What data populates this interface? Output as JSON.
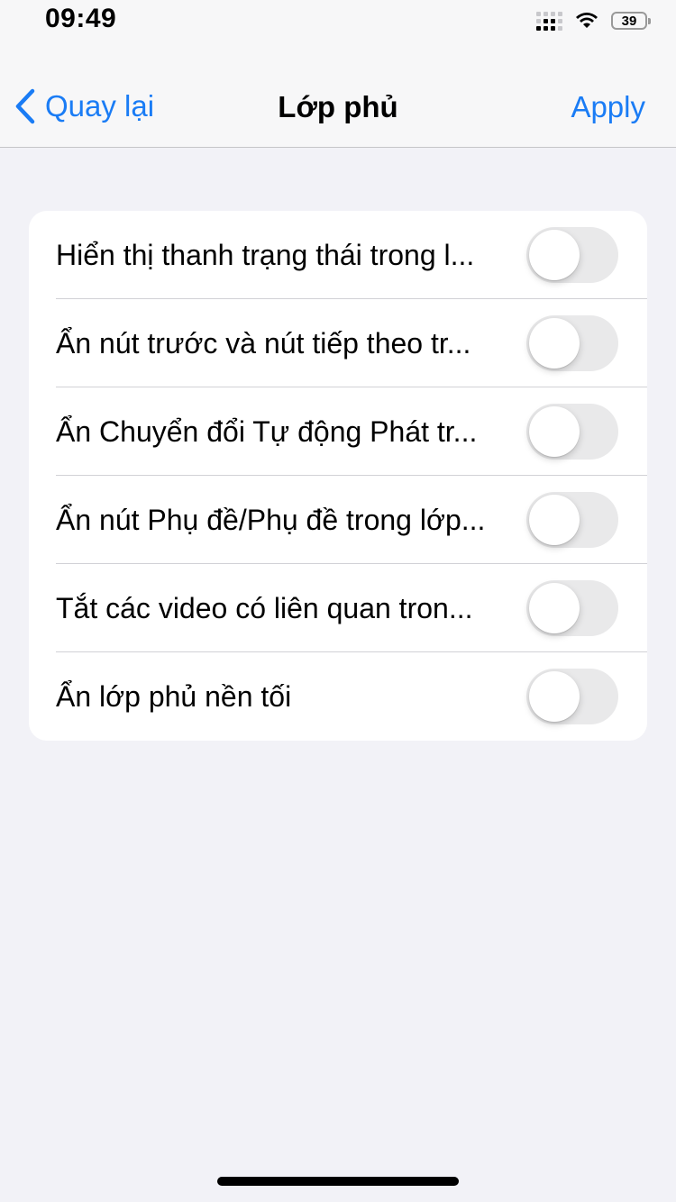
{
  "status_bar": {
    "time": "09:49",
    "battery": "39",
    "icons": [
      "cellular-signal-icon",
      "wifi-icon",
      "battery-icon"
    ]
  },
  "nav": {
    "back_label": "Quay lại",
    "title": "Lớp phủ",
    "apply_label": "Apply",
    "accent_color": "#1a7cf5"
  },
  "settings": {
    "items": [
      {
        "label": "Hiển thị thanh trạng thái trong l...",
        "enabled": false
      },
      {
        "label": "Ẩn nút trước và nút tiếp theo tr...",
        "enabled": false
      },
      {
        "label": "Ẩn Chuyển đổi Tự động Phát tr...",
        "enabled": false
      },
      {
        "label": "Ẩn nút Phụ đề/Phụ đề trong lớp...",
        "enabled": false
      },
      {
        "label": "Tắt các video có liên quan tron...",
        "enabled": false
      },
      {
        "label": "Ẩn lớp phủ nền tối",
        "enabled": false
      }
    ]
  }
}
